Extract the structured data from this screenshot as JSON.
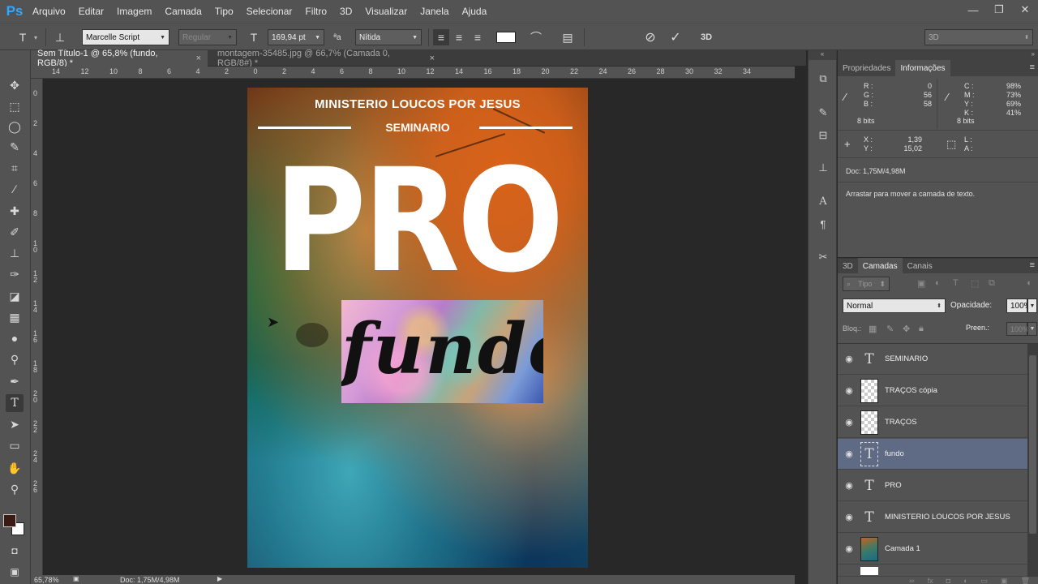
{
  "app": {
    "logo": "Ps"
  },
  "menu": [
    "Arquivo",
    "Editar",
    "Imagem",
    "Camada",
    "Tipo",
    "Selecionar",
    "Filtro",
    "3D",
    "Visualizar",
    "Janela",
    "Ajuda"
  ],
  "window_controls": {
    "minimize": "—",
    "restore": "❐",
    "close": "✕"
  },
  "options": {
    "font_family": "Marcelle Script",
    "font_style": "Regular",
    "font_size": "169,94 pt",
    "antialias": "Nítida",
    "workspace": "3D",
    "cancel_icon": "cancel-icon",
    "commit_icon": "commit-icon",
    "text_color": "#ffffff"
  },
  "tabs": [
    {
      "label": "Sem Título-1 @ 65,8% (fundo, RGB/8) *",
      "close": "×",
      "active": true
    },
    {
      "label": "montagem-35485.jpg @ 66,7% (Camada 0, RGB/8#) *",
      "close": "×",
      "active": false
    }
  ],
  "rulers": {
    "h": [
      "14",
      "12",
      "10",
      "8",
      "6",
      "4",
      "2",
      "0",
      "2",
      "4",
      "6",
      "8",
      "10",
      "12",
      "14",
      "16",
      "18",
      "20",
      "22",
      "24",
      "26",
      "28",
      "30",
      "32",
      "34"
    ],
    "v": [
      "0",
      "2",
      "4",
      "6",
      "8",
      "1 0",
      "1 2",
      "1 4",
      "1 6",
      "1 8",
      "2 0",
      "2 2",
      "2 4",
      "2 6"
    ]
  },
  "poster": {
    "title": "MINISTERIO LOUCOS POR JESUS",
    "subtitle": "SEMINARIO",
    "pro": "PRO",
    "fundo": "fundo"
  },
  "status": {
    "zoom": "65,78%",
    "doc": "Doc: 1,75M/4,98M"
  },
  "info_panel": {
    "tabs": [
      "Propriedades",
      "Informações"
    ],
    "rgb": {
      "R": "0",
      "G": "56",
      "B": "58"
    },
    "cmyk": {
      "C": "98%",
      "M": "73%",
      "Y": "69%",
      "K": "41%"
    },
    "bits_left": "8 bits",
    "bits_right": "8 bits",
    "x": "1,39",
    "y": "15,02",
    "l": "",
    "a": "",
    "doc": "Doc: 1,75M/4,98M",
    "hint": "Arrastar para mover a camada de texto."
  },
  "layers_panel": {
    "tabs": [
      "3D",
      "Camadas",
      "Canais"
    ],
    "filter": "Tipo",
    "blend_mode": "Normal",
    "opacity_label": "Opacidade:",
    "opacity": "100%",
    "lock_label": "Bloq.:",
    "fill_label": "Preen.:",
    "fill": "100%",
    "layers": [
      {
        "name": "SEMINARIO",
        "kind": "text",
        "selected": false
      },
      {
        "name": "TRAÇOS cópia",
        "kind": "trans",
        "selected": false
      },
      {
        "name": "TRAÇOS",
        "kind": "trans",
        "selected": false
      },
      {
        "name": "fundo",
        "kind": "text",
        "selected": true
      },
      {
        "name": "PRO",
        "kind": "text",
        "selected": false
      },
      {
        "name": "MINISTERIO LOUCOS POR JESUS",
        "kind": "text",
        "selected": false
      },
      {
        "name": "Camada 1",
        "kind": "img",
        "selected": false
      }
    ]
  },
  "colors": {
    "foreground": "#3a1a12",
    "background": "#ffffff",
    "selected_layer": "#5f6a85",
    "accent": "#31a8ff"
  }
}
